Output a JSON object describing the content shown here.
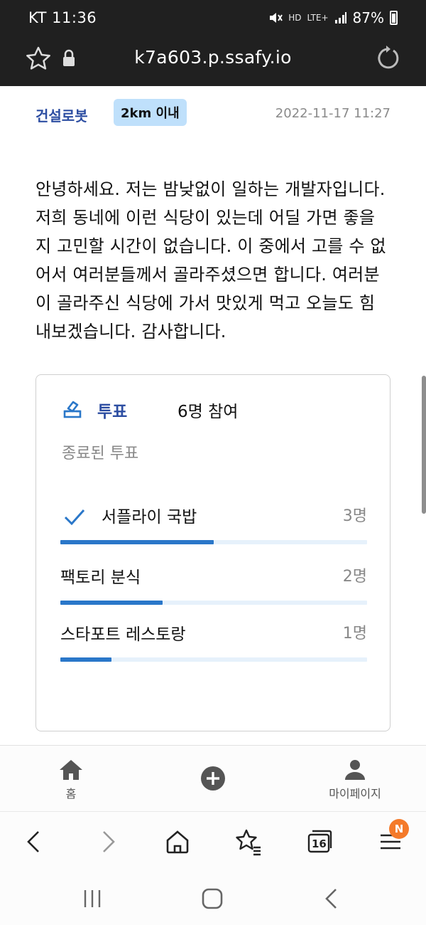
{
  "status_bar": {
    "carrier_time": "KT 11:36",
    "network": "LTE+",
    "hd_label": "HD",
    "battery": "87%"
  },
  "browser": {
    "url": "k7a603.p.ssafy.io",
    "tab_count": "16",
    "menu_badge": "N"
  },
  "post": {
    "category": "건설로봇",
    "distance_badge": "2km 이내",
    "date": "2022-11-17 11:27",
    "body": "안녕하세요. 저는 밤낮없이 일하는 개발자입니다. 저희 동네에 이런 식당이 있는데 어딜 가면 좋을지 고민할 시간이 없습니다. 이 중에서 고를 수 없어서 여러분들께서 골라주셨으면 합니다. 여러분이 골라주신 식당에 가서 맛있게 먹고 오늘도 힘내보겠습니다. 감사합니다."
  },
  "poll": {
    "label": "투표",
    "participants": "6명 참여",
    "status": "종료된 투표",
    "options": [
      {
        "name": "서플라이 국밥",
        "votes": "3명",
        "fraction": 0.5,
        "selected": true
      },
      {
        "name": "팩토리 분식",
        "votes": "2명",
        "fraction": 0.333,
        "selected": false
      },
      {
        "name": "스타포트 레스토랑",
        "votes": "1명",
        "fraction": 0.167,
        "selected": false
      }
    ],
    "accent_color": "#2a77c9"
  },
  "app_nav": {
    "home_label": "홈",
    "mypage_label": "마이페이지"
  },
  "icons": [
    "star-icon",
    "lock-icon",
    "reload-icon",
    "vote-icon",
    "check-icon",
    "home-icon",
    "add-icon",
    "person-icon",
    "back-icon",
    "forward-icon",
    "browser-home-icon",
    "bookmarks-icon",
    "tabs-icon",
    "menu-icon",
    "recents-icon",
    "home-button-icon",
    "system-back-icon"
  ]
}
